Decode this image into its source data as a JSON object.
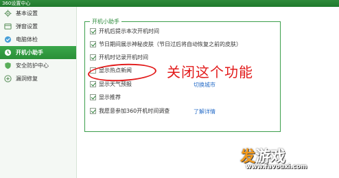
{
  "window": {
    "title": "360设置中心"
  },
  "sidebar": {
    "items": [
      {
        "label": "基本设置",
        "icon": "gear-icon",
        "active": false
      },
      {
        "label": "弹窗设置",
        "icon": "popup-icon",
        "active": false
      },
      {
        "label": "电脑体检",
        "icon": "checkup-icon",
        "active": false
      },
      {
        "label": "开机小助手",
        "icon": "boot-assistant-icon",
        "active": true
      },
      {
        "label": "安全防护中心",
        "icon": "shield-icon",
        "active": false
      },
      {
        "label": "漏洞修复",
        "icon": "patch-icon",
        "active": false
      }
    ]
  },
  "group": {
    "legend": "开机小助手",
    "options": [
      {
        "label": "开机后提示本次开机时间",
        "checked": true
      },
      {
        "label": "节日期间展示神秘皮肤（节日过后将自动恢复之前的皮肤）",
        "checked": true
      },
      {
        "label": "开机时记录开机时间",
        "checked": true
      },
      {
        "label": "显示热点新闻",
        "checked": false
      },
      {
        "label": "显示天气预报",
        "checked": true
      },
      {
        "label": "显示推荐",
        "checked": true
      },
      {
        "label": "我愿意参加360开机时间调查",
        "checked": true
      }
    ],
    "switch_city_link": "切换城市",
    "learn_more_link": "了解详情"
  },
  "annotation": {
    "text": "关闭这个功能",
    "color": "#e21a1a"
  },
  "watermark": {
    "logo_a": "发",
    "logo_b": "游戏",
    "url": "www.favouxi.com"
  },
  "colors": {
    "accent": "#2a8f38",
    "annotation": "#e21a1a",
    "link": "#2a6fc9"
  }
}
